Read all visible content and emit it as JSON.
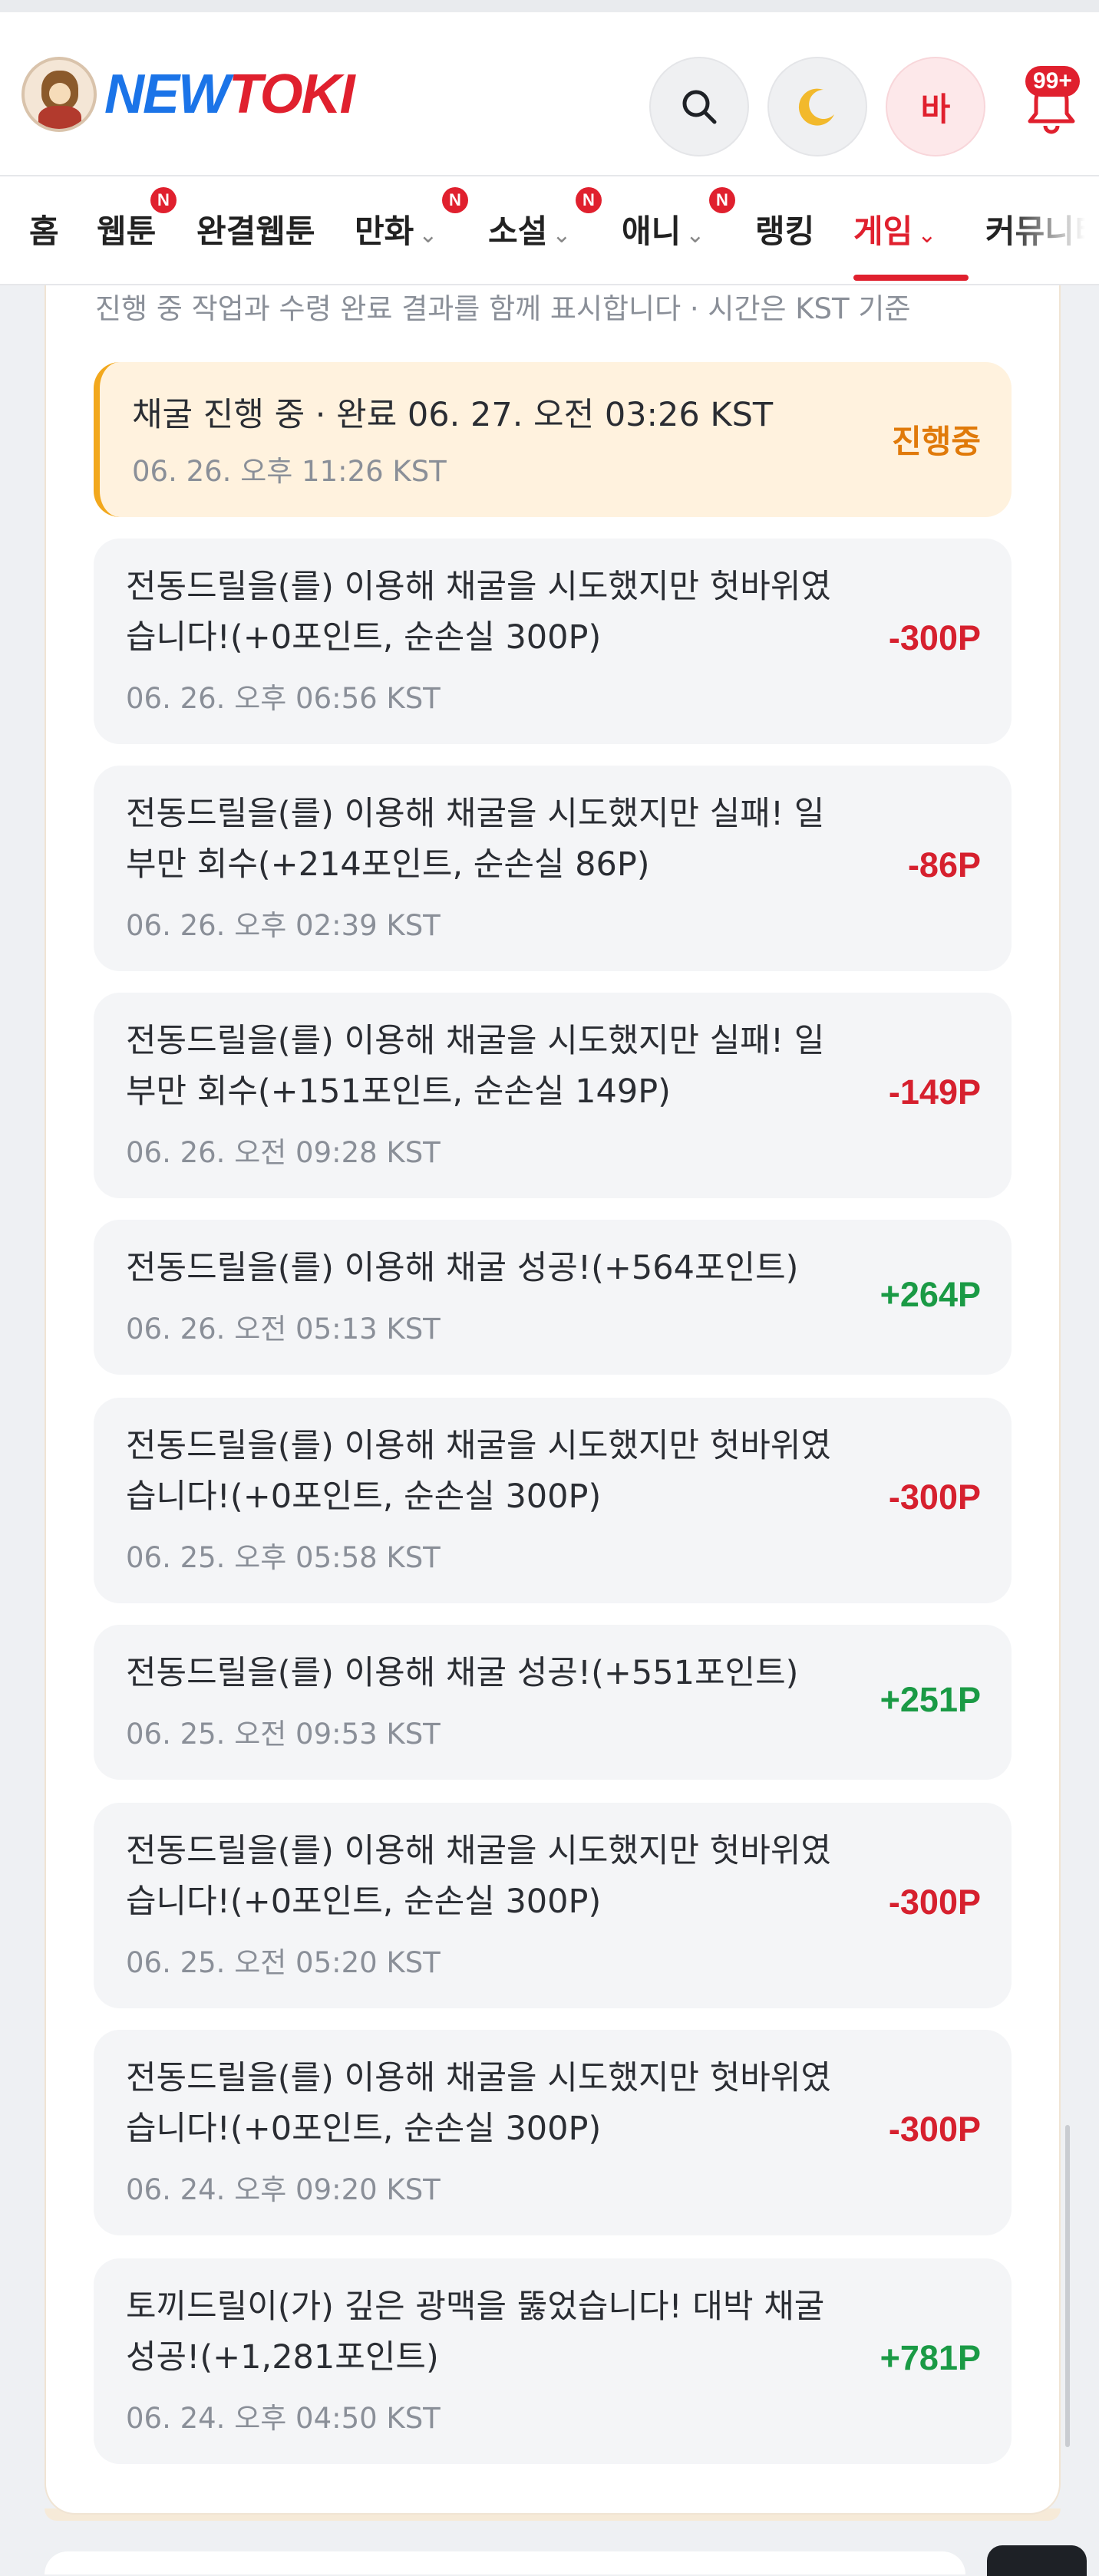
{
  "header": {
    "logo_part1": "NEW",
    "logo_part2": "TOKI",
    "avatar_label": "바",
    "notification_badge": "99+"
  },
  "nav": {
    "items": [
      {
        "label": "홈",
        "has_badge": false,
        "has_chevron": false
      },
      {
        "label": "웹툰",
        "has_badge": true,
        "has_chevron": false
      },
      {
        "label": "완결웹툰",
        "has_badge": false,
        "has_chevron": false
      },
      {
        "label": "만화",
        "has_badge": true,
        "has_chevron": true
      },
      {
        "label": "소설",
        "has_badge": true,
        "has_chevron": true
      },
      {
        "label": "애니",
        "has_badge": true,
        "has_chevron": true
      },
      {
        "label": "랭킹",
        "has_badge": false,
        "has_chevron": false
      },
      {
        "label": "게임",
        "has_badge": false,
        "has_chevron": true,
        "active": true
      },
      {
        "label": "커뮤니티",
        "has_badge": false,
        "has_chevron": false
      }
    ],
    "badge_text": "N",
    "chevron_glyph": "⌄"
  },
  "notice": "진행 중 작업과 수령 완료 결과를 함께 표시합니다 · 시간은 KST 기준",
  "entries": [
    {
      "text": "채굴 진행 중 · 완료 06. 27. 오전 03:26 KST",
      "time": "06. 26. 오후 11:26 KST",
      "amount": "진행중",
      "status": "progress"
    },
    {
      "text": "전동드릴을(를) 이용해 채굴을 시도했지만 헛바위였습니다!(+0포인트, 순손실 300P)",
      "time": "06. 26. 오후 06:56 KST",
      "amount": "-300P",
      "status": "neg"
    },
    {
      "text": "전동드릴을(를) 이용해 채굴을 시도했지만 실패! 일부만 회수(+214포인트, 순손실 86P)",
      "time": "06. 26. 오후 02:39 KST",
      "amount": "-86P",
      "status": "neg"
    },
    {
      "text": "전동드릴을(를) 이용해 채굴을 시도했지만 실패! 일부만 회수(+151포인트, 순손실 149P)",
      "time": "06. 26. 오전 09:28 KST",
      "amount": "-149P",
      "status": "neg"
    },
    {
      "text": "전동드릴을(를) 이용해 채굴 성공!(+564포인트)",
      "time": "06. 26. 오전 05:13 KST",
      "amount": "+264P",
      "status": "pos"
    },
    {
      "text": "전동드릴을(를) 이용해 채굴을 시도했지만 헛바위였습니다!(+0포인트, 순손실 300P)",
      "time": "06. 25. 오후 05:58 KST",
      "amount": "-300P",
      "status": "neg"
    },
    {
      "text": "전동드릴을(를) 이용해 채굴 성공!(+551포인트)",
      "time": "06. 25. 오전 09:53 KST",
      "amount": "+251P",
      "status": "pos"
    },
    {
      "text": "전동드릴을(를) 이용해 채굴을 시도했지만 헛바위였습니다!(+0포인트, 순손실 300P)",
      "time": "06. 25. 오전 05:20 KST",
      "amount": "-300P",
      "status": "neg"
    },
    {
      "text": "전동드릴을(를) 이용해 채굴을 시도했지만 헛바위였습니다!(+0포인트, 순손실 300P)",
      "time": "06. 24. 오후 09:20 KST",
      "amount": "-300P",
      "status": "neg"
    },
    {
      "text": "토끼드릴이(가) 깊은 광맥을 뚫었습니다! 대박 채굴 성공!(+1,281포인트)",
      "time": "06. 24. 오후 04:50 KST",
      "amount": "+781P",
      "status": "pos"
    }
  ],
  "colors": {
    "brand_red": "#e0202e",
    "brand_blue": "#1b74e8",
    "loss": "#d6202e",
    "gain": "#1a9a45",
    "progress": "#e07a0a"
  },
  "icons": {
    "search": "search-icon",
    "theme": "moon-icon",
    "notifications": "bell-icon"
  }
}
